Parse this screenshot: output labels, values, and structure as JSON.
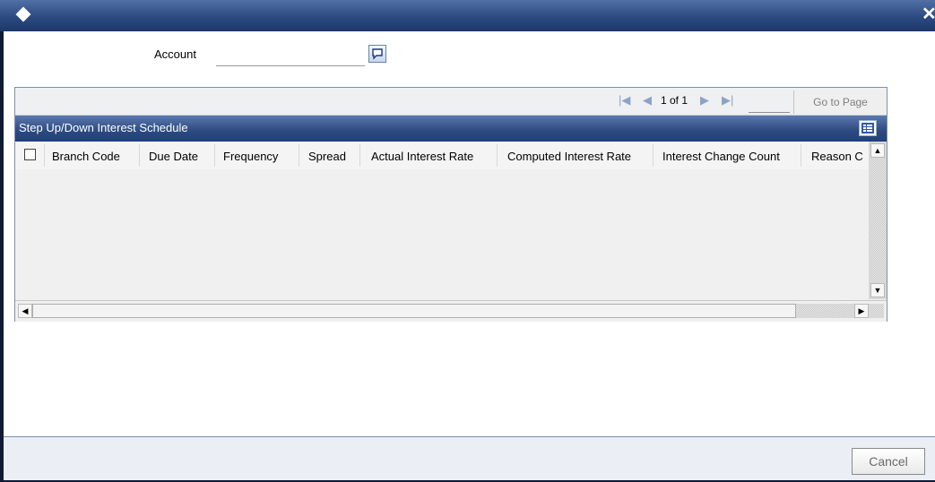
{
  "form": {
    "account_label": "Account",
    "account_value": ""
  },
  "pagination": {
    "first_icon": "first-page-icon",
    "prev_icon": "prev-page-icon",
    "page_text": "1 of 1",
    "next_icon": "next-page-icon",
    "last_icon": "last-page-icon",
    "page_input_value": "",
    "goto_label": "Go to Page"
  },
  "schedule": {
    "title": "Step Up/Down Interest Schedule",
    "columns": [
      "Branch Code",
      "Due Date",
      "Frequency",
      "Spread",
      "Actual Interest Rate",
      "Computed Interest Rate",
      "Interest Change Count",
      "Reason C"
    ],
    "rows": []
  },
  "footer": {
    "cancel_label": "Cancel"
  },
  "colors": {
    "titlebar": "#2c4a80",
    "border": "#7d8fae",
    "footer_bg": "#eceef6"
  }
}
